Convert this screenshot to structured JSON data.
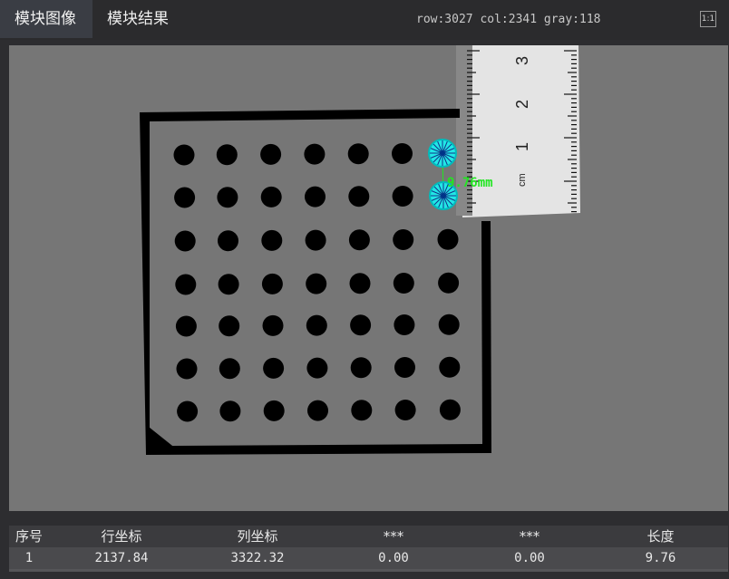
{
  "tabs": [
    {
      "label": "模块图像"
    },
    {
      "label": "模块结果"
    }
  ],
  "status": "row:3027 col:2341 gray:118",
  "fit_button": "1:1",
  "image": {
    "ruler_labels": [
      "3",
      "2",
      "1",
      "cm"
    ],
    "measurement_label": "9.76mm",
    "colors": {
      "background": "#767676",
      "marker": "#22e6e6",
      "measure_text": "#22e622"
    }
  },
  "table": {
    "headers": [
      "序号",
      "行坐标",
      "列坐标",
      "***",
      "***",
      "长度"
    ],
    "rows": [
      [
        "1",
        "2137.84",
        "3322.32",
        "0.00",
        "0.00",
        "9.76"
      ]
    ]
  }
}
